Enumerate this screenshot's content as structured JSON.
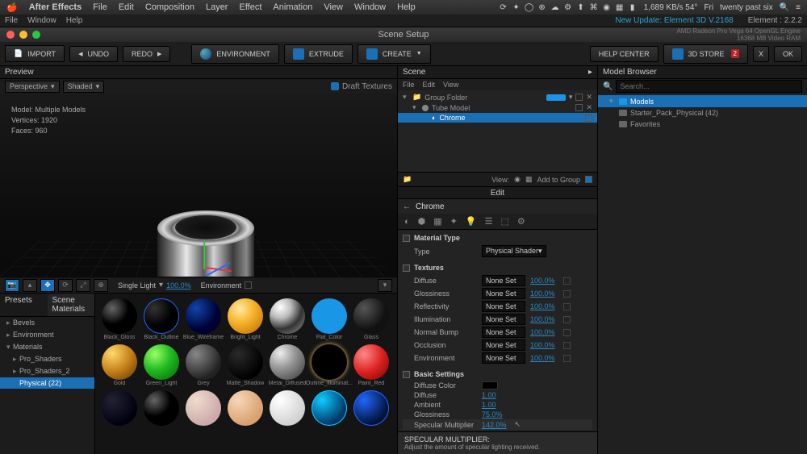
{
  "macmenu": {
    "app": "After Effects",
    "items": [
      "File",
      "Edit",
      "Composition",
      "Layer",
      "Effect",
      "Animation",
      "View",
      "Window",
      "Help"
    ],
    "clock": "twenty past six",
    "net": "1,689 KB/s 54°",
    "day": "Fri"
  },
  "e3dmenu": {
    "items": [
      "File",
      "Window",
      "Help"
    ],
    "update": "New Update: Element 3D V.2168",
    "version": "Element : 2.2.2"
  },
  "wintitle": "Scene Setup",
  "gpu": {
    "l1": "AMD Radeon Pro Vega 64 OpenGL Engine",
    "l2": "16368 MB Video RAM"
  },
  "toolbar": {
    "import": "IMPORT",
    "undo": "UNDO",
    "redo": "REDO",
    "env": "ENVIRONMENT",
    "extrude": "EXTRUDE",
    "create": "CREATE",
    "help": "HELP CENTER",
    "store": "3D STORE",
    "storebadge": "2",
    "x": "X",
    "ok": "OK"
  },
  "preview": {
    "title": "Preview",
    "persp": "Perspective",
    "shaded": "Shaded",
    "draft": "Draft Textures",
    "model_label": "Model:",
    "model": "Multiple Models",
    "verts_label": "Vertices:",
    "verts": "1920",
    "faces_label": "Faces:",
    "faces": "960",
    "light_label": "Single Light",
    "light_val": "100.0%",
    "env_label": "Environment"
  },
  "presets": {
    "tab1": "Presets",
    "tab2": "Scene Materials",
    "tree": [
      "Bevels",
      "Environment",
      "Materials",
      "Pro_Shaders",
      "Pro_Shaders_2",
      "Physical (22)"
    ],
    "mats": [
      [
        "Black_Gloss",
        "Black_Outline",
        "Blue_Wireframe",
        "Bright_Light",
        "Chrome",
        "Flat_Color",
        "Glass"
      ],
      [
        "Gold",
        "Green_Light",
        "Grey",
        "Matte_Shadow",
        "Metal_Diffused",
        "Outline_Illuminat...",
        "Paint_Red"
      ],
      [
        "",
        "",
        "",
        "",
        "",
        "",
        ""
      ]
    ]
  },
  "scene": {
    "title": "Scene",
    "menu": [
      "File",
      "Edit",
      "View"
    ],
    "rows": [
      {
        "label": "Group Folder",
        "indent": 0
      },
      {
        "label": "Tube Model",
        "indent": 1
      },
      {
        "label": "Chrome",
        "indent": 2,
        "sel": true
      }
    ],
    "view": "View:",
    "add": "Add to Group"
  },
  "edit": {
    "title": "Edit",
    "matname": "Chrome",
    "mattype_label": "Material Type",
    "type_label": "Type",
    "type_value": "Physical Shader",
    "textures_label": "Textures",
    "tex": {
      "diffuse": "Diffuse",
      "gloss": "Glossiness",
      "refl": "Reflectivity",
      "illum": "Illumination",
      "nbump": "Normal Bump",
      "occ": "Occlusion",
      "env": "Environment",
      "noneset": "None Set",
      "pct": "100.0%"
    },
    "basic_label": "Basic Settings",
    "basic": {
      "dcolor": "Diffuse Color",
      "diffuse": "Diffuse",
      "diffuse_v": "1.00",
      "ambient": "Ambient",
      "ambient_v": "1.00",
      "gloss": "Glossiness",
      "gloss_v": "75.0%",
      "spec": "Specular Multiplier",
      "spec_v": "142.0%"
    },
    "tooltip_title": "SPECULAR MULTIPLIER:",
    "tooltip_body": "Adjust the amount of specular lighting received."
  },
  "browser": {
    "title": "Model Browser",
    "placeholder": "Search...",
    "models": "Models",
    "pack": "Starter_Pack_Physical (42)",
    "fav": "Favorites"
  }
}
